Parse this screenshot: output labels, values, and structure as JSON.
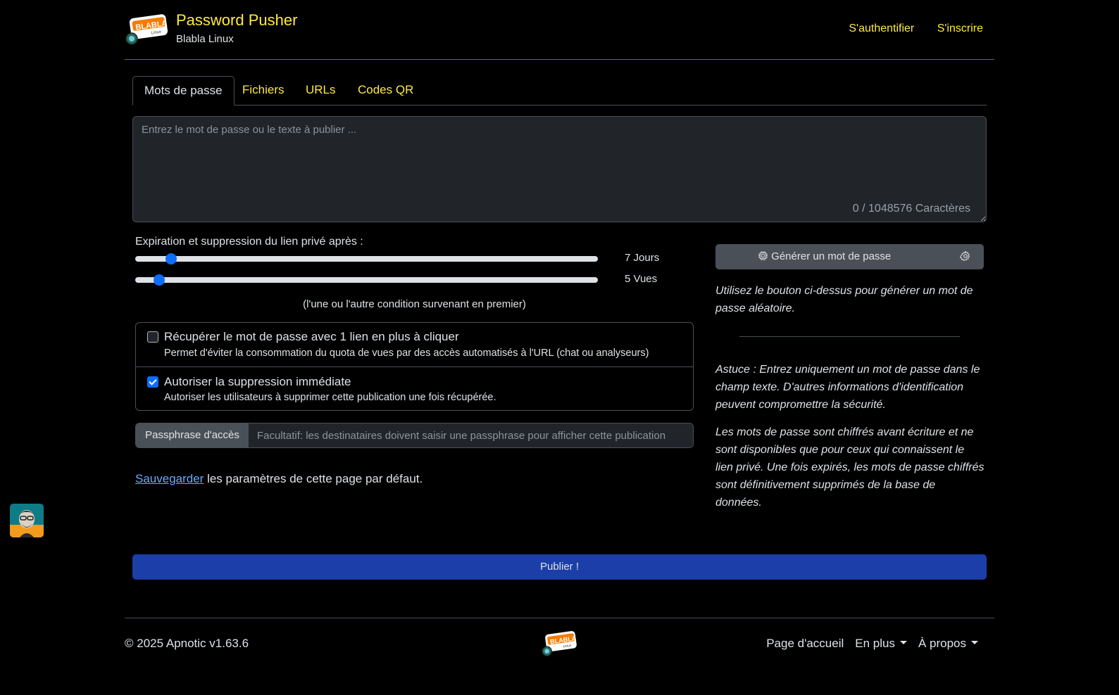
{
  "header": {
    "title": "Password Pusher",
    "subtitle": "Blabla Linux",
    "nav": [
      "S'authentifier",
      "S'inscrire"
    ],
    "logo_text": "BLABLA",
    "logo_sub": "Linux"
  },
  "tabs": [
    "Mots de passe",
    "Fichiers",
    "URLs",
    "Codes QR"
  ],
  "active_tab": "Mots de passe",
  "editor": {
    "placeholder": "Entrez le mot de passe ou le texte à publier ...",
    "char_count": "0 / 1048576 Caractères"
  },
  "expiration": {
    "label": "Expiration et suppression du lien privé après :",
    "days_label": "7 Jours",
    "days_level": 0.077,
    "views_label": "5 Vues",
    "views_level": 0.051,
    "note": "(l'une ou l'autre condition survenant en premier)"
  },
  "options": [
    {
      "title": "Récupérer le mot de passe avec 1 lien en plus à cliquer",
      "desc": "Permet d'éviter la consommation du quota de vues par des accès automatisés à l'URL (chat ou analyseurs)",
      "checked": false
    },
    {
      "title": "Autoriser la suppression immédiate",
      "desc": "Autoriser les utilisateurs à supprimer cette publication une fois récupérée.",
      "checked": true
    }
  ],
  "passphrase": {
    "label": "Passphrase d'accès",
    "placeholder": "Facultatif: les destinataires doivent saisir une passphrase pour afficher cette publication"
  },
  "save": {
    "link": "Sauvegarder",
    "text": " les paramètres de cette page par défaut."
  },
  "generator": {
    "button": "Générer un mot de passe",
    "hint": "Utilisez le bouton ci-dessus pour générer un mot de passe aléatoire.",
    "tip": "Astuce : Entrez uniquement un mot de passe dans le champ texte. D'autres informations d'identification peuvent compromettre la sécurité.",
    "info": "Les mots de passe sont chiffrés avant écriture et ne sont disponibles que pour ceux qui connaissent le lien privé. Une fois expirés, les mots de passe chiffrés sont définitivement supprimés de la base de données."
  },
  "publish": "Publier !",
  "footer": {
    "copyright": "© 2025 Apnotic v1.63.6",
    "nav": [
      "Page d'accueil",
      "En plus",
      "À propos"
    ]
  },
  "colors": {
    "accent_link": "#ffeb3b",
    "primary": "#0d6efd",
    "publish_bg": "#1c3ea8",
    "background": "#000000"
  }
}
